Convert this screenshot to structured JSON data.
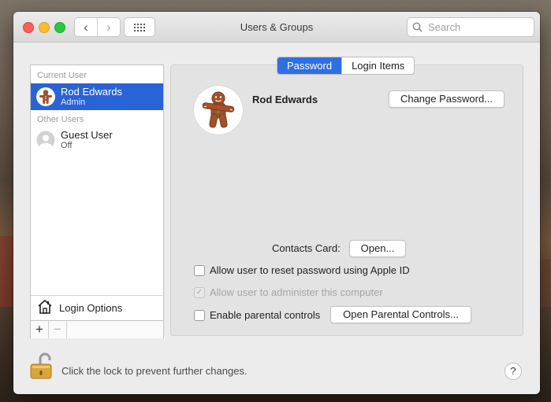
{
  "window": {
    "title": "Users & Groups"
  },
  "toolbar": {
    "back_glyph": "‹",
    "forward_glyph": "›",
    "search_placeholder": "Search"
  },
  "sidebar": {
    "current_user_label": "Current User",
    "current_user": {
      "name": "Rod Edwards",
      "role": "Admin"
    },
    "other_users_label": "Other Users",
    "other_users": [
      {
        "name": "Guest User",
        "status": "Off"
      }
    ],
    "login_options_label": "Login Options",
    "add_label": "+",
    "remove_label": "−"
  },
  "tabs": [
    {
      "label": "Password",
      "active": true
    },
    {
      "label": "Login Items",
      "active": false
    }
  ],
  "details": {
    "full_name": "Rod Edwards",
    "change_password_label": "Change Password...",
    "contacts_card_label": "Contacts Card:",
    "open_label": "Open...",
    "checkbox_reset_label": "Allow user to reset password using Apple ID",
    "checkbox_reset_checked": false,
    "checkbox_admin_label": "Allow user to administer this computer",
    "checkbox_admin_checked": true,
    "checkbox_admin_disabled": true,
    "checkbox_parental_label": "Enable parental controls",
    "checkbox_parental_checked": false,
    "open_parental_label": "Open Parental Controls..."
  },
  "footer": {
    "lock_text": "Click the lock to prevent further changes.",
    "help_label": "?"
  },
  "icons": [
    "back-arrow-icon",
    "forward-arrow-icon",
    "grid-icon",
    "search-icon",
    "gingerbread-avatar-icon",
    "guest-user-icon",
    "house-icon",
    "unlocked-padlock-icon",
    "help-icon"
  ],
  "colors": {
    "accent": "#2f6fe6",
    "selection": "#2a63d8",
    "close": "#fe5f57",
    "minimize": "#febc2e",
    "zoom": "#28c840"
  }
}
